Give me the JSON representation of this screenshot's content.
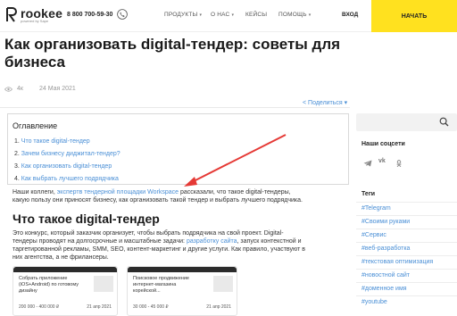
{
  "header": {
    "logo_text": "rookee",
    "logo_sub": "powered by Sape",
    "phone": "8 800 700-59-30",
    "nav": [
      {
        "label": "ПРОДУКТЫ",
        "has_caret": true
      },
      {
        "label": "О НАС",
        "has_caret": true
      },
      {
        "label": "КЕЙСЫ",
        "has_caret": false
      },
      {
        "label": "ПОМОЩЬ",
        "has_caret": true
      }
    ],
    "login": "ВХОД",
    "start": "НАЧАТЬ"
  },
  "article": {
    "title": "Как организовать digital-тендер: советы для бизнеса",
    "views": "4к",
    "date": "24 Мая 2021",
    "share": "Поделиться"
  },
  "toc": {
    "title": "Оглавление",
    "items": [
      {
        "num": "1.",
        "label": "Что такое digital-тендер"
      },
      {
        "num": "2.",
        "label": "Зачем бизнесу диджитал-тендер?"
      },
      {
        "num": "3.",
        "label": "Как организовать digital-тендер"
      },
      {
        "num": "4.",
        "label": "Как выбрать лучшего подрядчика"
      }
    ]
  },
  "intro": {
    "before": "Наши коллеги,",
    "link": "экспертв тендерной площадки Workspace",
    "after": "рассказали, что такое digital-тендеры,",
    "line2": "какую пользу они приносят бизнесу, как организовать такой тендер и выбрать лучшего подрядчика."
  },
  "section": {
    "heading": "Что такое digital-тендер",
    "p1": "Это конкурс, который заказчик организует, чтобы выбрать подрядчика на свой проект. Digital-",
    "p2_before": "тендеры проводят на долгосрочные и масштабные задачи:",
    "p2_link": "разработку сайта",
    "p2_after": ", запуск контекстной и",
    "p3": "таргетированной рекламы, SMM, SEO, контент-маркетинг и другие услуги. Как правило, участвуют в",
    "p4": "них агентства, а не фрилансеры."
  },
  "cards": [
    {
      "title": "Собрать приложение (iOS+Android) по готовому дизайну",
      "price": "200 000 - 400 000 ₽",
      "date": "21 апр 2021"
    },
    {
      "title": "Поисковое продвижение интернет-магазина корейской...",
      "price": "30 000 - 45 000 ₽",
      "date": "21 апр 2021"
    }
  ],
  "sidebar": {
    "social_heading": "Наши соцсети",
    "social": [
      "telegram-icon",
      "vk-icon",
      "ok-icon"
    ],
    "tags_heading": "Теги",
    "tags": [
      "#Telegram",
      "#Своими руками",
      "#Сервис",
      "#веб-разработка",
      "#текстовая оптимизация",
      "#новостной сайт",
      "#доменное имя",
      "#youtube"
    ]
  },
  "colors": {
    "accent_yellow": "#ffe11f",
    "link_blue": "#4a8fd6",
    "arrow_red": "#e53935"
  }
}
